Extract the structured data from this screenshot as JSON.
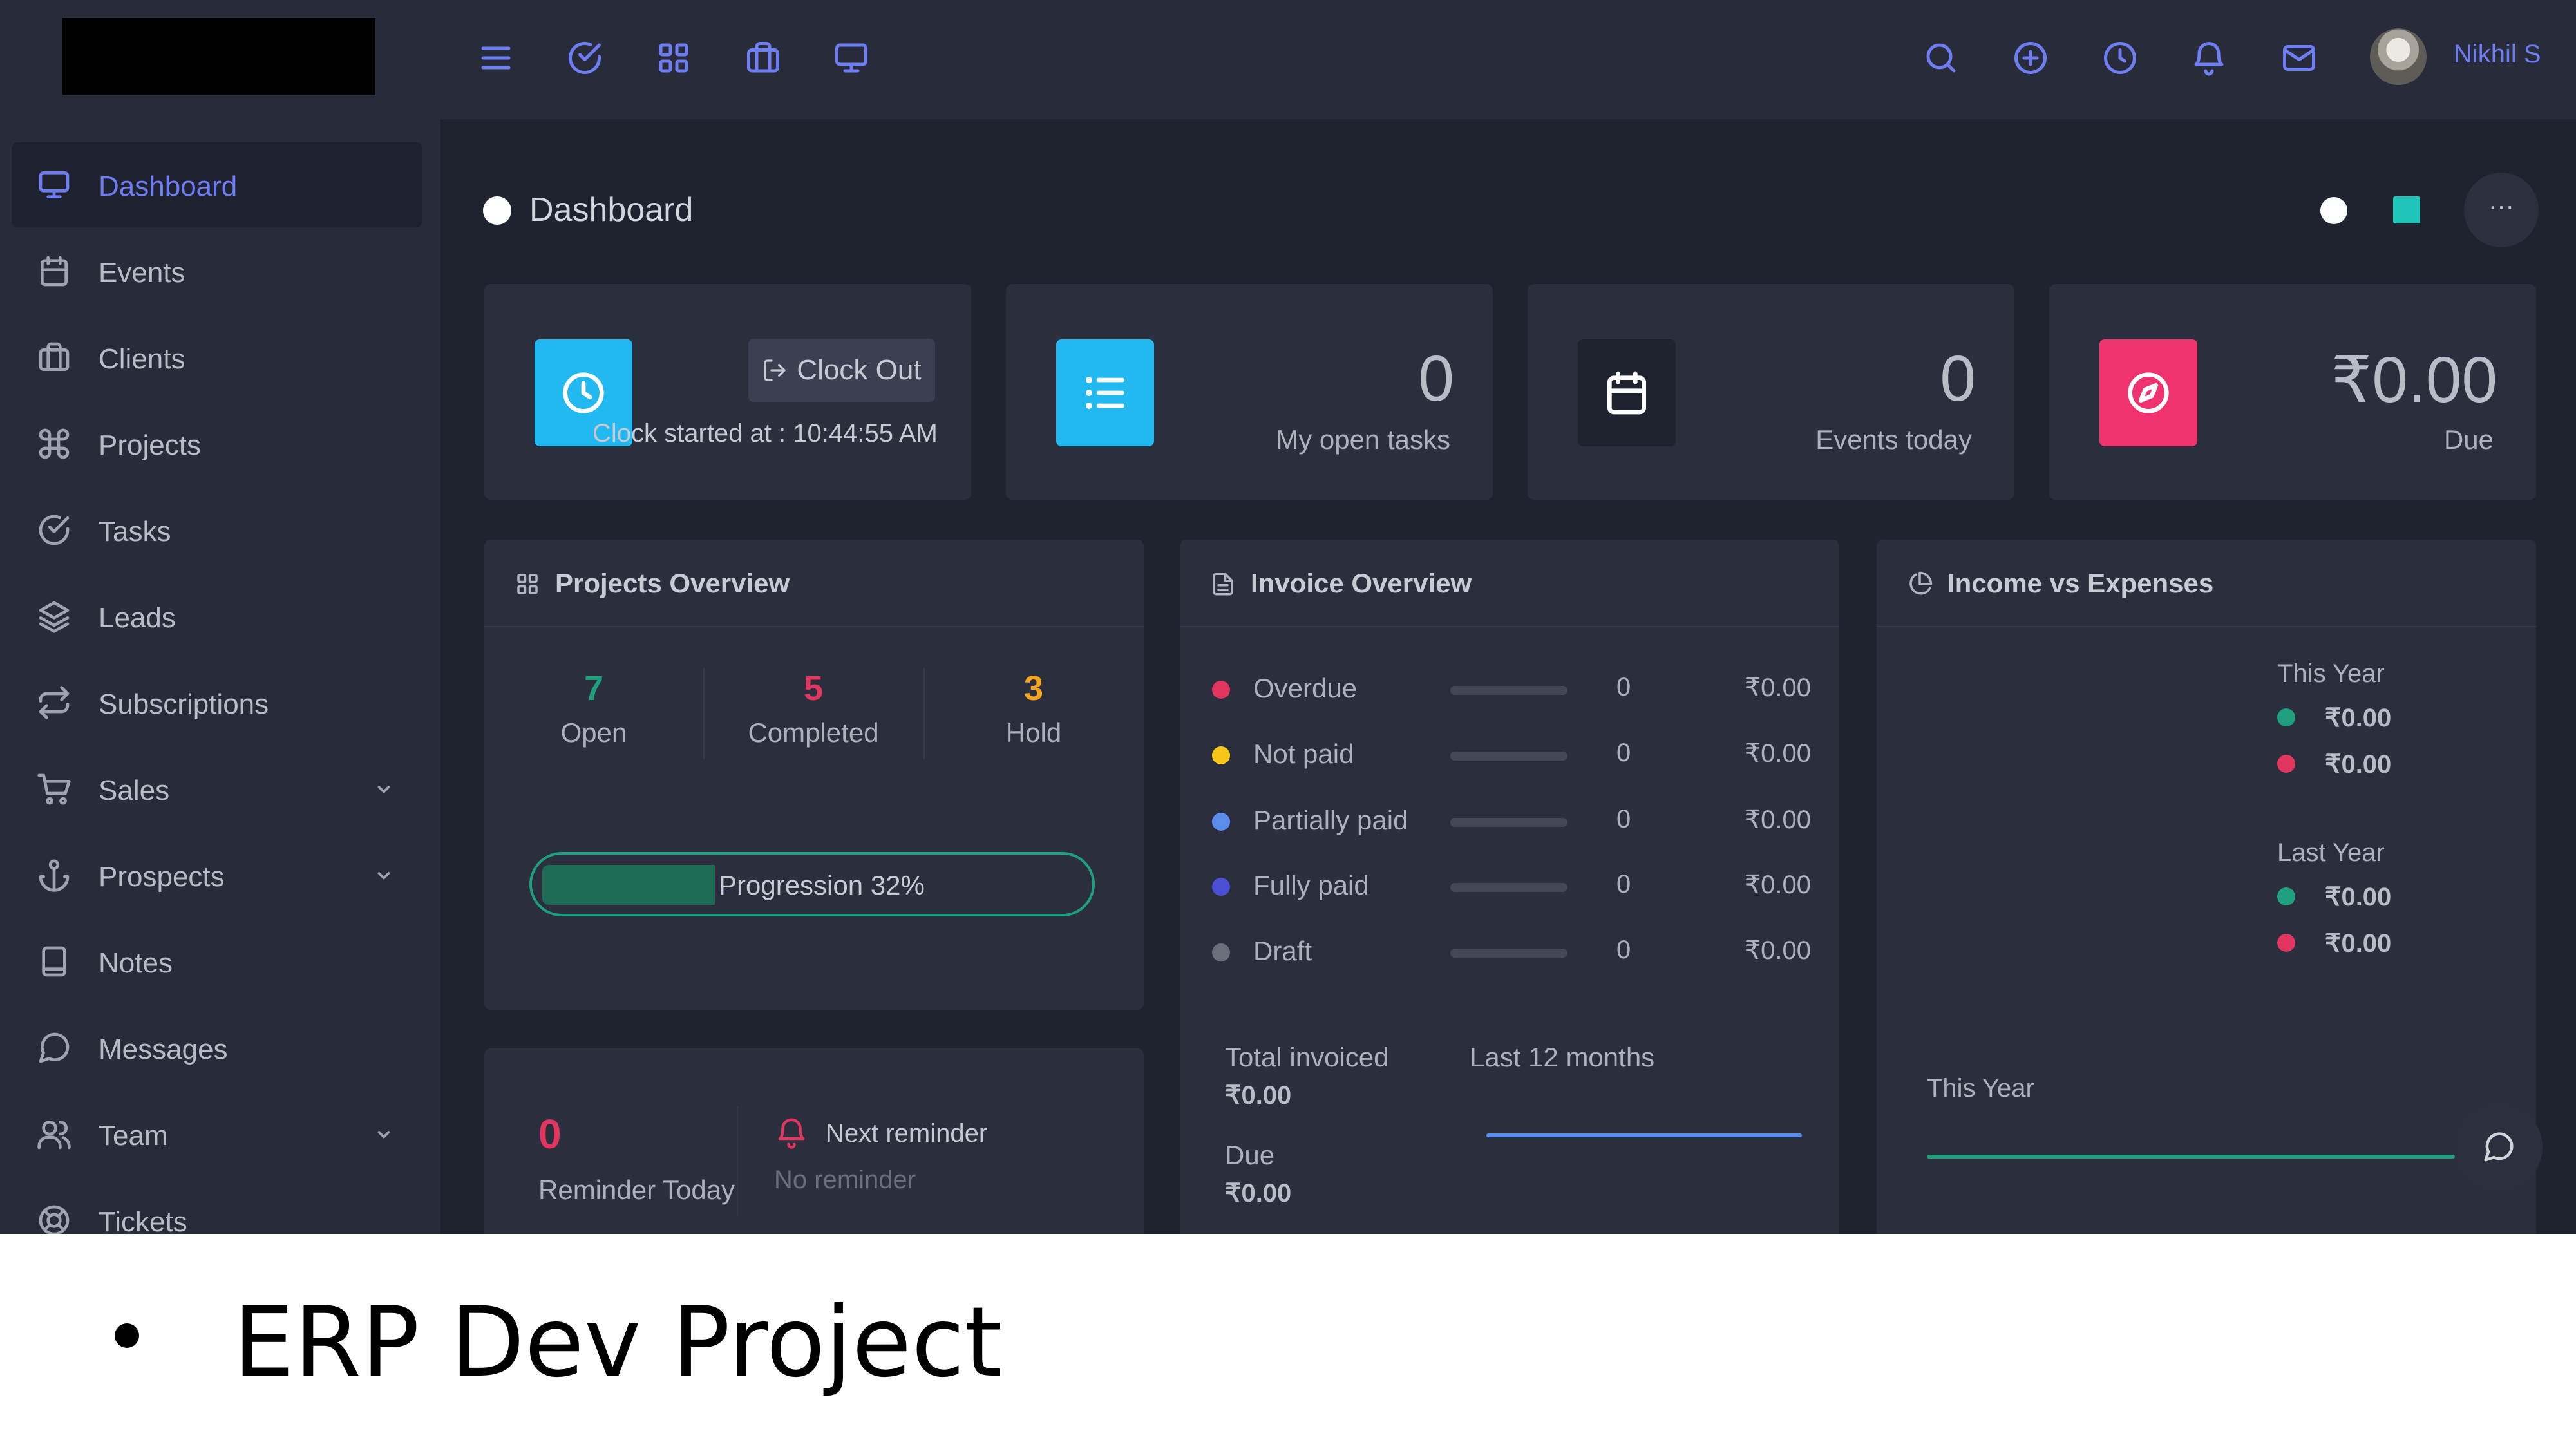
{
  "topbar": {
    "username": "Nikhil S",
    "left_icons": [
      "menu-icon",
      "check-circle-icon",
      "grid-icon",
      "briefcase-icon",
      "monitor-icon"
    ],
    "right_icons": [
      "search-icon",
      "plus-circle-icon",
      "clock-icon",
      "bell-icon",
      "mail-icon"
    ]
  },
  "sidebar": {
    "items": [
      {
        "label": "Dashboard",
        "icon": "monitor-icon",
        "active": true
      },
      {
        "label": "Events",
        "icon": "calendar-icon"
      },
      {
        "label": "Clients",
        "icon": "briefcase-icon"
      },
      {
        "label": "Projects",
        "icon": "command-icon"
      },
      {
        "label": "Tasks",
        "icon": "check-circle-icon"
      },
      {
        "label": "Leads",
        "icon": "layers-icon"
      },
      {
        "label": "Subscriptions",
        "icon": "repeat-icon"
      },
      {
        "label": "Sales",
        "icon": "cart-icon",
        "has_submenu": true
      },
      {
        "label": "Prospects",
        "icon": "anchor-icon",
        "has_submenu": true
      },
      {
        "label": "Notes",
        "icon": "book-icon"
      },
      {
        "label": "Messages",
        "icon": "message-circle-icon"
      },
      {
        "label": "Team",
        "icon": "users-icon",
        "has_submenu": true
      },
      {
        "label": "Tickets",
        "icon": "life-buoy-icon"
      }
    ]
  },
  "header": {
    "title": "Dashboard",
    "more_label": "···"
  },
  "colors": {
    "accent": "#6f7df2",
    "sky": "#22b8f0",
    "pink": "#f0326e",
    "teal": "#21c4b8",
    "green": "#1e9f7e",
    "red": "#e1365f",
    "yellow": "#f5c518",
    "blue": "#5b8dee",
    "indigo": "#4a4fd6",
    "grey": "#6b6f7c"
  },
  "stats": {
    "clock": {
      "button_label": "Clock Out",
      "started_text": "Clock started at : 10:44:55 AM"
    },
    "open_tasks": {
      "value": "0",
      "label": "My open tasks"
    },
    "events_today": {
      "value": "0",
      "label": "Events today"
    },
    "due": {
      "value": "₹0.00",
      "label": "Due"
    }
  },
  "projects_overview": {
    "title": "Projects Overview",
    "columns": [
      {
        "value": "7",
        "label": "Open",
        "color": "#1e9f7e"
      },
      {
        "value": "5",
        "label": "Completed",
        "color": "#e1365f"
      },
      {
        "value": "3",
        "label": "Hold",
        "color": "#f5a623"
      }
    ],
    "progress_label": "Progression 32%",
    "progress_fraction": 0.32
  },
  "reminder": {
    "count": "0",
    "count_label": "Reminder Today",
    "next_label": "Next reminder",
    "next_value": "No reminder"
  },
  "invoice_overview": {
    "title": "Invoice Overview",
    "rows": [
      {
        "label": "Overdue",
        "count": "0",
        "amount": "₹0.00",
        "color": "#e1365f"
      },
      {
        "label": "Not paid",
        "count": "0",
        "amount": "₹0.00",
        "color": "#f5c518"
      },
      {
        "label": "Partially paid",
        "count": "0",
        "amount": "₹0.00",
        "color": "#5b8dee"
      },
      {
        "label": "Fully paid",
        "count": "0",
        "amount": "₹0.00",
        "color": "#4a4fd6"
      },
      {
        "label": "Draft",
        "count": "0",
        "amount": "₹0.00",
        "color": "#6b6f7c"
      }
    ],
    "total_label": "Total invoiced",
    "total_value": "₹0.00",
    "due_label": "Due",
    "due_value": "₹0.00",
    "period_label": "Last 12 months"
  },
  "income_expenses": {
    "title": "Income vs Expenses",
    "this_year_label": "This Year",
    "this_year_income": "₹0.00",
    "this_year_expense": "₹0.00",
    "last_year_label": "Last Year",
    "last_year_income": "₹0.00",
    "last_year_expense": "₹0.00",
    "chart_label": "This Year"
  },
  "slide": {
    "caption": "ERP Dev Project"
  }
}
